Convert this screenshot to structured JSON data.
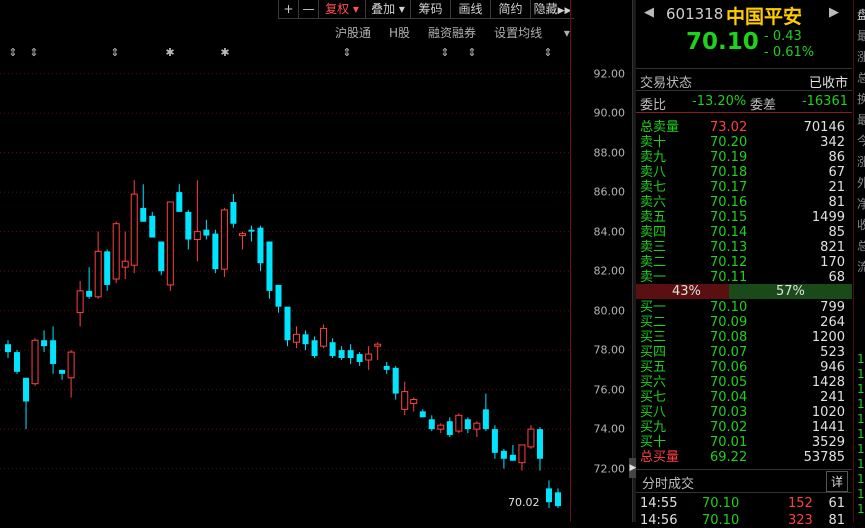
{
  "toolbar": {
    "buttons": [
      "+",
      "—",
      "复权",
      "叠加",
      "筹码",
      "画线",
      "简约",
      "隐藏"
    ]
  },
  "subbar": [
    "沪股通",
    "H股",
    "融资融券",
    "设置均线"
  ],
  "price_axis": [
    "92.00",
    "90.00",
    "88.00",
    "86.00",
    "84.00",
    "82.00",
    "80.00",
    "78.00",
    "76.00",
    "74.00",
    "72.00"
  ],
  "last_price_label": "70.02",
  "colors": {
    "up": "#ff4040",
    "down": "#00e5ff",
    "axis_line": "#8b1a1a",
    "green": "#1dd11d"
  },
  "chart_data": {
    "type": "candlestick",
    "ylim": [
      69.5,
      93.5
    ],
    "candles": [
      [
        78.3,
        78.5,
        77.6,
        77.9
      ],
      [
        77.9,
        78.0,
        76.8,
        76.9
      ],
      [
        76.6,
        76.6,
        74.0,
        75.4
      ],
      [
        76.3,
        78.6,
        76.2,
        78.5
      ],
      [
        78.5,
        79.0,
        77.9,
        78.2
      ],
      [
        78.5,
        79.2,
        76.8,
        77.3
      ],
      [
        77.0,
        77.0,
        76.5,
        76.8
      ],
      [
        76.6,
        78.0,
        75.6,
        77.9
      ],
      [
        79.9,
        81.5,
        79.2,
        81.0
      ],
      [
        81.0,
        82.2,
        80.6,
        80.7
      ],
      [
        80.7,
        84.0,
        80.6,
        83.0
      ],
      [
        83.0,
        83.1,
        81.0,
        81.3
      ],
      [
        81.6,
        84.5,
        81.4,
        84.4
      ],
      [
        82.2,
        84.0,
        81.6,
        82.5
      ],
      [
        82.3,
        86.6,
        81.9,
        85.9
      ],
      [
        85.2,
        86.4,
        84.9,
        84.5
      ],
      [
        84.8,
        85.0,
        83.8,
        83.7
      ],
      [
        83.5,
        83.4,
        81.8,
        82.0
      ],
      [
        81.3,
        84.0,
        81.0,
        85.5
      ],
      [
        86.0,
        86.4,
        85.2,
        85.0
      ],
      [
        85.0,
        85.1,
        83.1,
        83.6
      ],
      [
        83.6,
        86.6,
        82.5,
        84.0
      ],
      [
        84.1,
        84.6,
        83.6,
        83.8
      ],
      [
        83.9,
        84.1,
        81.9,
        82.1
      ],
      [
        82.1,
        85.2,
        81.7,
        85.1
      ],
      [
        85.5,
        85.9,
        84.2,
        84.4
      ],
      [
        83.8,
        84.0,
        83.1,
        83.9
      ],
      [
        84.1,
        84.3,
        83.5,
        84.0
      ],
      [
        84.2,
        84.3,
        82.0,
        82.4
      ],
      [
        83.5,
        83.0,
        80.6,
        81.0
      ],
      [
        81.3,
        81.1,
        79.9,
        80.2
      ],
      [
        80.2,
        79.0,
        78.2,
        78.5
      ],
      [
        78.4,
        79.2,
        78.1,
        78.8
      ],
      [
        78.8,
        79.0,
        78.0,
        78.3
      ],
      [
        78.5,
        78.7,
        77.6,
        77.7
      ],
      [
        78.2,
        79.3,
        78.1,
        79.1
      ],
      [
        78.4,
        78.6,
        77.6,
        77.7
      ],
      [
        78.0,
        78.2,
        77.5,
        77.6
      ],
      [
        78.0,
        78.3,
        77.3,
        77.6
      ],
      [
        77.8,
        77.9,
        77.2,
        77.4
      ],
      [
        77.5,
        78.2,
        77.0,
        77.8
      ],
      [
        78.2,
        78.4,
        77.5,
        78.3
      ],
      [
        77.2,
        77.4,
        76.8,
        77.0
      ],
      [
        77.1,
        77.2,
        75.5,
        75.8
      ],
      [
        75.0,
        76.4,
        74.7,
        75.9
      ],
      [
        75.3,
        75.6,
        74.9,
        75.5
      ],
      [
        74.9,
        75.0,
        74.6,
        74.6
      ],
      [
        74.5,
        74.7,
        73.9,
        74.0
      ],
      [
        74.0,
        74.3,
        73.8,
        74.2
      ],
      [
        74.4,
        74.6,
        73.6,
        73.7
      ],
      [
        73.9,
        74.8,
        73.8,
        74.7
      ],
      [
        74.5,
        74.6,
        73.8,
        74.0
      ],
      [
        74.0,
        74.4,
        73.6,
        74.3
      ],
      [
        75.0,
        75.8,
        73.9,
        74.0
      ],
      [
        74.0,
        74.2,
        72.5,
        72.8
      ],
      [
        72.9,
        73.0,
        72.0,
        72.5
      ],
      [
        72.7,
        73.2,
        72.4,
        72.4
      ],
      [
        72.3,
        72.8,
        71.9,
        73.2
      ],
      [
        73.1,
        74.2,
        73.0,
        74.0
      ],
      [
        74.0,
        74.1,
        71.9,
        72.5
      ],
      [
        71.0,
        71.4,
        70.0,
        70.3
      ],
      [
        70.8,
        71.0,
        70.0,
        70.1
      ]
    ]
  },
  "markers": [
    "⇕",
    "⇕",
    "⇕",
    "✱",
    "✱",
    "⇕",
    "⇕",
    "⇕",
    "⇕"
  ],
  "quote": {
    "code": "601318",
    "name": "中国平安",
    "price": "70.10",
    "change": "- 0.43",
    "change_pct": "- 0.61%",
    "trade_status_label": "交易状态",
    "trade_status": "已收市",
    "weibi_label": "委比",
    "weibi": "-13.20%",
    "weicha_label": "委差",
    "weicha": "-16361",
    "total_sell_label": "总卖量",
    "total_sell_price": "73.02",
    "total_sell_vol": "70146",
    "sells": [
      {
        "label": "卖十",
        "price": "70.20",
        "vol": "342"
      },
      {
        "label": "卖九",
        "price": "70.19",
        "vol": "86"
      },
      {
        "label": "卖八",
        "price": "70.18",
        "vol": "67"
      },
      {
        "label": "卖七",
        "price": "70.17",
        "vol": "21"
      },
      {
        "label": "卖六",
        "price": "70.16",
        "vol": "81"
      },
      {
        "label": "卖五",
        "price": "70.15",
        "vol": "1499"
      },
      {
        "label": "卖四",
        "price": "70.14",
        "vol": "85"
      },
      {
        "label": "卖三",
        "price": "70.13",
        "vol": "821"
      },
      {
        "label": "卖二",
        "price": "70.12",
        "vol": "170"
      },
      {
        "label": "卖一",
        "price": "70.11",
        "vol": "68"
      }
    ],
    "ratio_left": "43%",
    "ratio_right": "57%",
    "ratio_left_fraction": 0.43,
    "buys": [
      {
        "label": "买一",
        "price": "70.10",
        "vol": "799"
      },
      {
        "label": "买二",
        "price": "70.09",
        "vol": "264"
      },
      {
        "label": "买三",
        "price": "70.08",
        "vol": "1200"
      },
      {
        "label": "买四",
        "price": "70.07",
        "vol": "523"
      },
      {
        "label": "买五",
        "price": "70.06",
        "vol": "946"
      },
      {
        "label": "买六",
        "price": "70.05",
        "vol": "1428"
      },
      {
        "label": "买七",
        "price": "70.04",
        "vol": "241"
      },
      {
        "label": "买八",
        "price": "70.03",
        "vol": "1020"
      },
      {
        "label": "买九",
        "price": "70.02",
        "vol": "1441"
      },
      {
        "label": "买十",
        "price": "70.01",
        "vol": "3529"
      }
    ],
    "total_buy_label": "总买量",
    "total_buy_price": "69.22",
    "total_buy_vol": "53785",
    "ticks_label": "分时成交",
    "detail_label": "详",
    "ticks": [
      {
        "time": "14:55",
        "price": "70.10",
        "vol": "152",
        "n": "61"
      },
      {
        "time": "14:56",
        "price": "70.10",
        "vol": "323",
        "n": "81"
      }
    ]
  },
  "edge_chars": [
    "盘",
    "最",
    "涨",
    "总",
    "换",
    "最",
    "今",
    "涨",
    "外",
    "净",
    "收",
    "总",
    "流"
  ],
  "edge_numbers": [
    "1",
    "1",
    "1",
    "1",
    "1",
    "1",
    "1",
    "1",
    "1",
    "1",
    "1"
  ]
}
